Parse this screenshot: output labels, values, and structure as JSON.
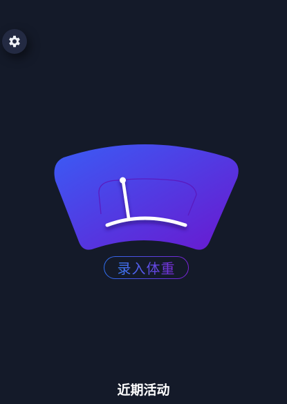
{
  "settings": {
    "icon": "gear-icon"
  },
  "hero": {
    "icon": "wiper-windshield-icon",
    "gradient": [
      "#3a5cf5",
      "#6a18cf"
    ]
  },
  "record_button": {
    "label": "录入体重"
  },
  "recent": {
    "title": "近期活动"
  }
}
